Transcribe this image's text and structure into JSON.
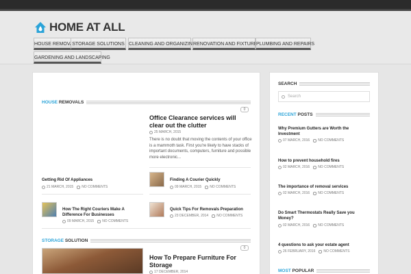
{
  "site": {
    "logo_text": "HOME AT ALL"
  },
  "nav": {
    "items": [
      {
        "label": "House Removals"
      },
      {
        "label": "Storage Solutions"
      },
      {
        "label": "Cleaning and Organizing"
      },
      {
        "label": "Renovation and Fixtures"
      },
      {
        "label": "Plumbing and Repairs"
      },
      {
        "label": "Gardening and Landscaping"
      }
    ]
  },
  "house_section": {
    "accent": "HOUSE",
    "rest": " REMOVALS"
  },
  "featured": {
    "title": "Office Clearance services will clear out the clutter",
    "date": "25 MARCH, 2015",
    "comments": "0",
    "excerpt": "There is no doubt that moving the contents of your office is a mammoth task. First you're likely to have stacks of important documents, computers, furniture and possible more electronic..."
  },
  "posts": [
    {
      "title": "Getting Rid Of Appliances",
      "date": "21 MARCH, 2015",
      "comments": "NO COMMENTS"
    },
    {
      "title": "Finding A Courier Quickly",
      "date": "09 MARCH, 2015",
      "comments": "NO COMMENTS"
    },
    {
      "title": "How The Right Couriers Make A Difference For Businesses",
      "date": "09 MARCH, 2015",
      "comments": "NO COMMENTS"
    },
    {
      "title": "Quick Tips For Removals Preparation",
      "date": "23 DECEMBER, 2014",
      "comments": "NO COMMENTS"
    }
  ],
  "storage_section": {
    "accent": "STORAGE",
    "rest": " SOLUTION"
  },
  "storage_featured": {
    "title": "How To Prepare Furniture For Storage",
    "date": "17 DECEMBER, 2014",
    "comments": "0"
  },
  "sidebar": {
    "search_title": "SEARCH",
    "search_placeholder": "Search",
    "recent_accent": "RECENT",
    "recent_rest": " POSTS",
    "recent": [
      {
        "title": "Why Premium Gutters are Worth the Investment",
        "date": "07 MARCH, 2016",
        "comments": "NO COMMENTS"
      },
      {
        "title": "How to prevent household fires",
        "date": "02 MARCH, 2016",
        "comments": "NO COMMENTS"
      },
      {
        "title": "The importance of removal services",
        "date": "02 MARCH, 2016",
        "comments": "NO COMMENTS"
      },
      {
        "title": "Do Smart Thermostats Really Save you Money?",
        "date": "02 MARCH, 2016",
        "comments": "NO COMMENTS"
      },
      {
        "title": "4 questions to ask your estate agent",
        "date": "26 FEBRUARY, 2016",
        "comments": "NO COMMENTS"
      }
    ],
    "popular_accent": "MOST",
    "popular_rest": " POPULAR"
  },
  "colors": {
    "accent": "#2aa3d8",
    "topbar": "#2b2b2b",
    "background": "#e6e6e6"
  }
}
